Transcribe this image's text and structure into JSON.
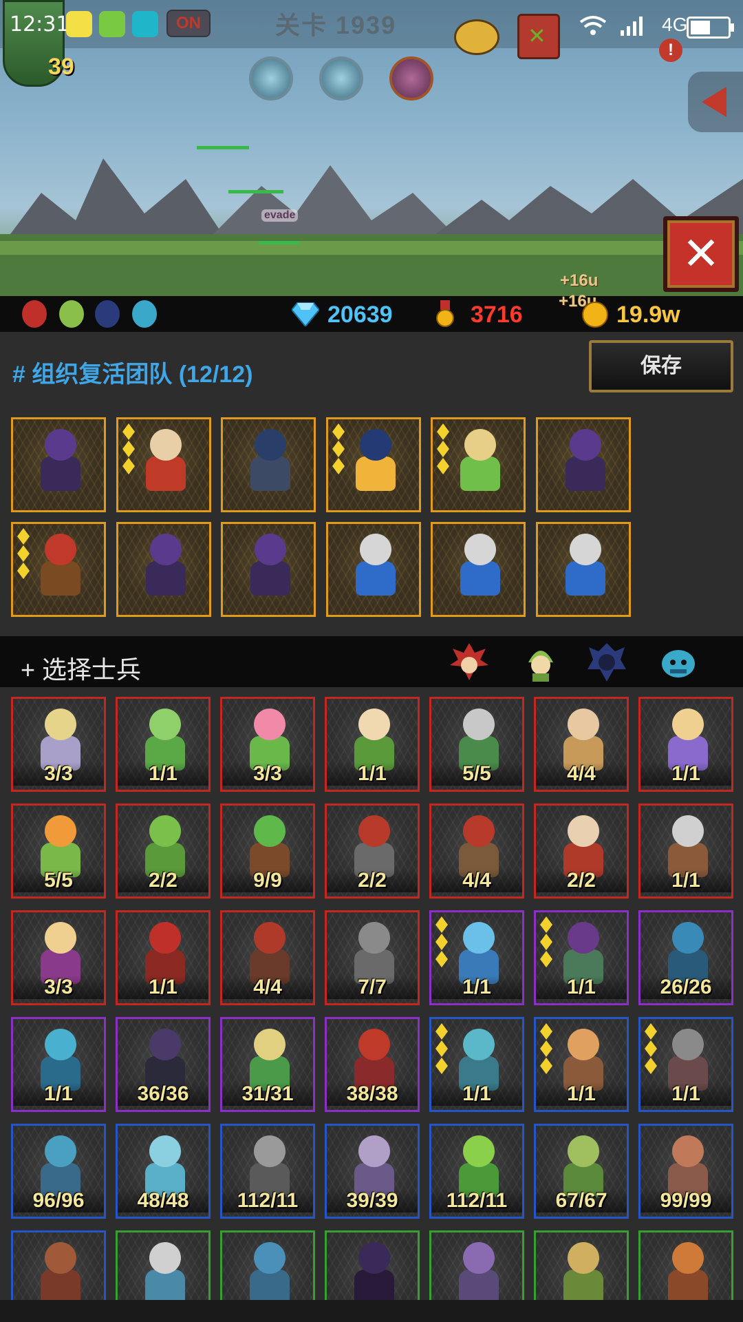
{
  "status_bar": {
    "time": "12:31",
    "on_badge": "ON",
    "network": "4G",
    "icons": [
      "app-yellow-icon",
      "browser-icon",
      "scan-icon",
      "wifi-icon",
      "signal-icon",
      "battery-icon"
    ]
  },
  "scene": {
    "level_title": "关卡 1939",
    "player_level": "39",
    "evade_text": "evade",
    "floating_1": "+16u",
    "floating_2": "+16u",
    "close_label": "✕"
  },
  "resources": {
    "diamonds": "20639",
    "medals": "3716",
    "gold": "19.9w",
    "colors": {
      "diamond": "#4fc3f7",
      "medal": "#ff3b2e",
      "gold": "#f7c741"
    }
  },
  "team": {
    "title": "# 组织复活团队 (12/12)",
    "save_label": "保存",
    "members": [
      {
        "name": "purple-hood-archer",
        "stars": 0,
        "head": "#5a3a8c",
        "body": "#3a2a5a"
      },
      {
        "name": "staff-king",
        "stars": 3,
        "head": "#e8cfa8",
        "body": "#c03a28"
      },
      {
        "name": "dark-knight",
        "stars": 0,
        "head": "#2a3e6a",
        "body": "#3d4a66"
      },
      {
        "name": "samurai-lord",
        "stars": 3,
        "head": "#243a74",
        "body": "#f0b43a"
      },
      {
        "name": "green-archer",
        "stars": 3,
        "head": "#e8cf88",
        "body": "#6fbf4a"
      },
      {
        "name": "purple-hood-archer",
        "stars": 0,
        "head": "#5a3a8c",
        "body": "#3a2a5a"
      },
      {
        "name": "griffin-rider",
        "stars": 3,
        "head": "#c0392b",
        "body": "#7a4a22"
      },
      {
        "name": "purple-hood-archer",
        "stars": 0,
        "head": "#5a3a8c",
        "body": "#3a2a5a"
      },
      {
        "name": "purple-hood-archer",
        "stars": 0,
        "head": "#5a3a8c",
        "body": "#3a2a5a"
      },
      {
        "name": "horned-blue-knight",
        "stars": 0,
        "head": "#d6d6d6",
        "body": "#2f6bc8"
      },
      {
        "name": "horned-blue-knight",
        "stars": 0,
        "head": "#d6d6d6",
        "body": "#2f6bc8"
      },
      {
        "name": "horned-blue-knight",
        "stars": 0,
        "head": "#d6d6d6",
        "body": "#2f6bc8"
      }
    ]
  },
  "soldiers": {
    "title": "+ 选择士兵",
    "filters": [
      "red-faction-icon",
      "green-faction-icon",
      "dark-faction-icon",
      "blue-faction-icon"
    ],
    "units": [
      {
        "count": "3/3",
        "rarity": "red",
        "stars": 0,
        "head": "#e6d48a",
        "body": "#a8a0c8"
      },
      {
        "count": "1/1",
        "rarity": "red",
        "stars": 0,
        "head": "#8fd06a",
        "body": "#5aa846"
      },
      {
        "count": "3/3",
        "rarity": "red",
        "stars": 0,
        "head": "#f08aa8",
        "body": "#6ab84a"
      },
      {
        "count": "1/1",
        "rarity": "red",
        "stars": 0,
        "head": "#f0d8b0",
        "body": "#5a9a3a"
      },
      {
        "count": "5/5",
        "rarity": "red",
        "stars": 0,
        "head": "#c8c8c8",
        "body": "#4a8a4a"
      },
      {
        "count": "4/4",
        "rarity": "red",
        "stars": 0,
        "head": "#e8c8a0",
        "body": "#c89a5a"
      },
      {
        "count": "1/1",
        "rarity": "red",
        "stars": 0,
        "head": "#f0d090",
        "body": "#8a6acc"
      },
      {
        "count": "5/5",
        "rarity": "red",
        "stars": 0,
        "head": "#f09a3a",
        "body": "#7ab84a"
      },
      {
        "count": "2/2",
        "rarity": "red",
        "stars": 0,
        "head": "#7ac04a",
        "body": "#5a9a3a"
      },
      {
        "count": "9/9",
        "rarity": "red",
        "stars": 0,
        "head": "#5fb84a",
        "body": "#7a4a2a"
      },
      {
        "count": "2/2",
        "rarity": "red",
        "stars": 0,
        "head": "#b83a2a",
        "body": "#6a6a6a"
      },
      {
        "count": "4/4",
        "rarity": "red",
        "stars": 0,
        "head": "#b83a2a",
        "body": "#7a5a3a"
      },
      {
        "count": "2/2",
        "rarity": "red",
        "stars": 0,
        "head": "#e8d0b0",
        "body": "#b03a2a"
      },
      {
        "count": "1/1",
        "rarity": "red",
        "stars": 0,
        "head": "#d0d0d0",
        "body": "#8a5a3a"
      },
      {
        "count": "3/3",
        "rarity": "red",
        "stars": 0,
        "head": "#f0d090",
        "body": "#8a3a8a"
      },
      {
        "count": "1/1",
        "rarity": "red",
        "stars": 0,
        "head": "#c0302a",
        "body": "#8a2a22"
      },
      {
        "count": "4/4",
        "rarity": "red",
        "stars": 0,
        "head": "#b03a2a",
        "body": "#6a3a2a"
      },
      {
        "count": "7/7",
        "rarity": "red",
        "stars": 0,
        "head": "#8a8a8a",
        "body": "#6a6a6a"
      },
      {
        "count": "1/1",
        "rarity": "purple",
        "stars": 3,
        "head": "#6ac0e8",
        "body": "#3a7ab8"
      },
      {
        "count": "1/1",
        "rarity": "purple",
        "stars": 3,
        "head": "#6a3a8a",
        "body": "#4a7a5a"
      },
      {
        "count": "26/26",
        "rarity": "purple",
        "stars": 0,
        "head": "#3a8ab8",
        "body": "#2a5a7a"
      },
      {
        "count": "1/1",
        "rarity": "purple",
        "stars": 0,
        "head": "#4ab0d0",
        "body": "#2a6a8a"
      },
      {
        "count": "36/36",
        "rarity": "purple",
        "stars": 0,
        "head": "#4a3a6a",
        "body": "#2a2a3a"
      },
      {
        "count": "31/31",
        "rarity": "purple",
        "stars": 0,
        "head": "#e0d080",
        "body": "#4a9a4a"
      },
      {
        "count": "38/38",
        "rarity": "purple",
        "stars": 0,
        "head": "#c03a2a",
        "body": "#8a2a2a"
      },
      {
        "count": "1/1",
        "rarity": "blue",
        "stars": 3,
        "head": "#5ab8c8",
        "body": "#3a7a8a"
      },
      {
        "count": "1/1",
        "rarity": "blue",
        "stars": 3,
        "head": "#e0a060",
        "body": "#8a5a3a"
      },
      {
        "count": "1/1",
        "rarity": "blue",
        "stars": 3,
        "head": "#8a8a8a",
        "body": "#6a4a4a"
      },
      {
        "count": "96/96",
        "rarity": "blue",
        "stars": 0,
        "head": "#4aa0c0",
        "body": "#3a6a8a"
      },
      {
        "count": "48/48",
        "rarity": "blue",
        "stars": 0,
        "head": "#8ad0e0",
        "body": "#5ab0c8"
      },
      {
        "count": "112/11",
        "rarity": "blue",
        "stars": 0,
        "head": "#9a9a9a",
        "body": "#5a5a5a"
      },
      {
        "count": "39/39",
        "rarity": "blue",
        "stars": 0,
        "head": "#b0a0c8",
        "body": "#6a5a8a"
      },
      {
        "count": "112/11",
        "rarity": "blue",
        "stars": 0,
        "head": "#8ad04a",
        "body": "#4a9a3a"
      },
      {
        "count": "67/67",
        "rarity": "blue",
        "stars": 0,
        "head": "#a0c060",
        "body": "#5a8a3a"
      },
      {
        "count": "99/99",
        "rarity": "blue",
        "stars": 0,
        "head": "#c07a5a",
        "body": "#8a5a4a"
      },
      {
        "count": "",
        "rarity": "blue",
        "stars": 0,
        "head": "#a05a3a",
        "body": "#7a3a2a"
      },
      {
        "count": "",
        "rarity": "green",
        "stars": 0,
        "head": "#d0d0d0",
        "body": "#4a8aa8"
      },
      {
        "count": "",
        "rarity": "green",
        "stars": 0,
        "head": "#4a90b8",
        "body": "#3a6a8a"
      },
      {
        "count": "",
        "rarity": "green",
        "stars": 0,
        "head": "#3a2a5a",
        "body": "#2a1a3a"
      },
      {
        "count": "",
        "rarity": "green",
        "stars": 0,
        "head": "#8a6ab0",
        "body": "#5a4a7a"
      },
      {
        "count": "",
        "rarity": "green",
        "stars": 0,
        "head": "#d0b060",
        "body": "#6a8a3a"
      },
      {
        "count": "",
        "rarity": "green",
        "stars": 0,
        "head": "#d07a3a",
        "body": "#8a4a2a"
      }
    ]
  }
}
